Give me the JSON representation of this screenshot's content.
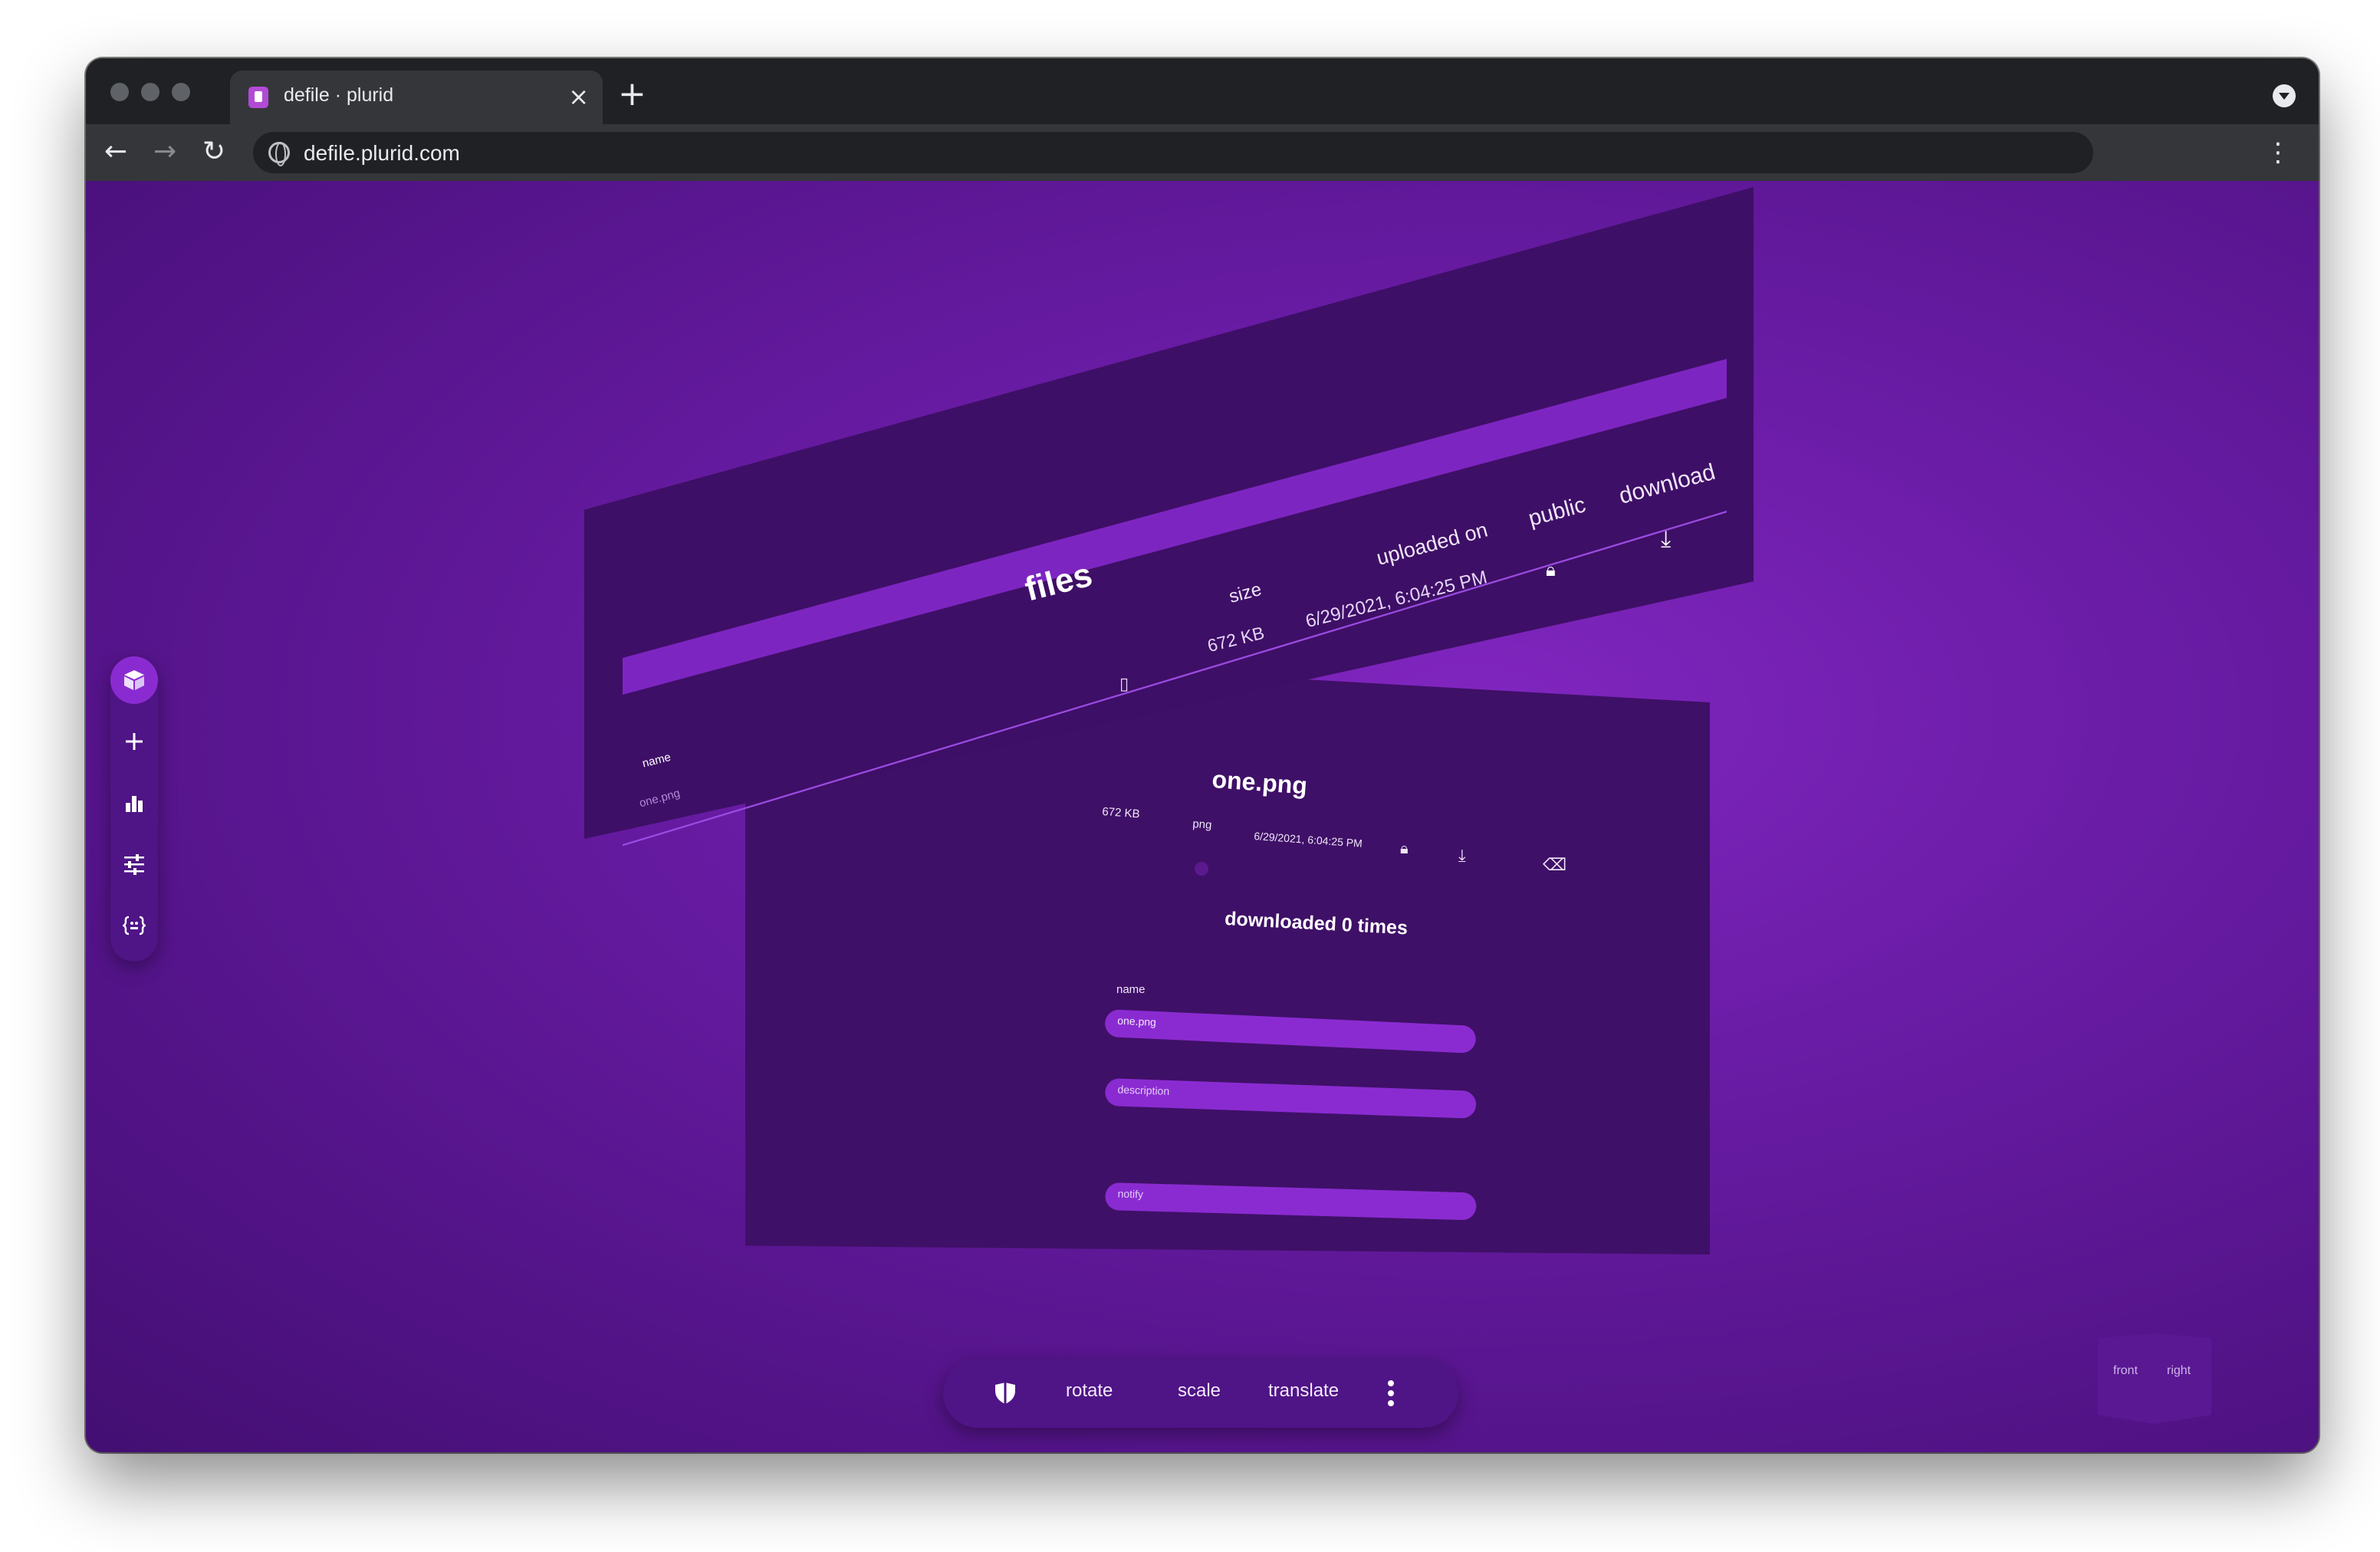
{
  "browser": {
    "tab_title": "defile · plurid",
    "url": "defile.plurid.com"
  },
  "files_plane": {
    "title": "files",
    "columns": {
      "name": "name",
      "size": "size",
      "uploaded_on": "uploaded on",
      "public": "public",
      "download": "download"
    },
    "rows": [
      {
        "name": "one.png",
        "size": "672 KB",
        "uploaded_on": "6/29/2021, 6:04:25 PM"
      }
    ]
  },
  "detail_plane": {
    "title": "one.png",
    "size": "672 KB",
    "type": "png",
    "uploaded_on": "6/29/2021, 6:04:25 PM",
    "downloads": "downloaded 0 times",
    "name_label": "name",
    "name_value": "one.png",
    "description_placeholder": "description",
    "notify_placeholder": "notify"
  },
  "bottom_toolbar": {
    "rotate": "rotate",
    "scale": "scale",
    "translate": "translate"
  },
  "orientation_cube": {
    "front": "front",
    "right": "right"
  },
  "colors": {
    "accent": "#8a2bd1",
    "background": "#6a1ca6",
    "plane": "#3e0f66",
    "toolbar": "#4f1486"
  },
  "icons": {
    "side_toolbar": [
      "cube-icon",
      "plus-icon",
      "bar-chart-icon",
      "sliders-icon",
      "code-icon"
    ],
    "bottom_toolbar": [
      "shield-icon",
      "more-vertical-icon"
    ]
  }
}
